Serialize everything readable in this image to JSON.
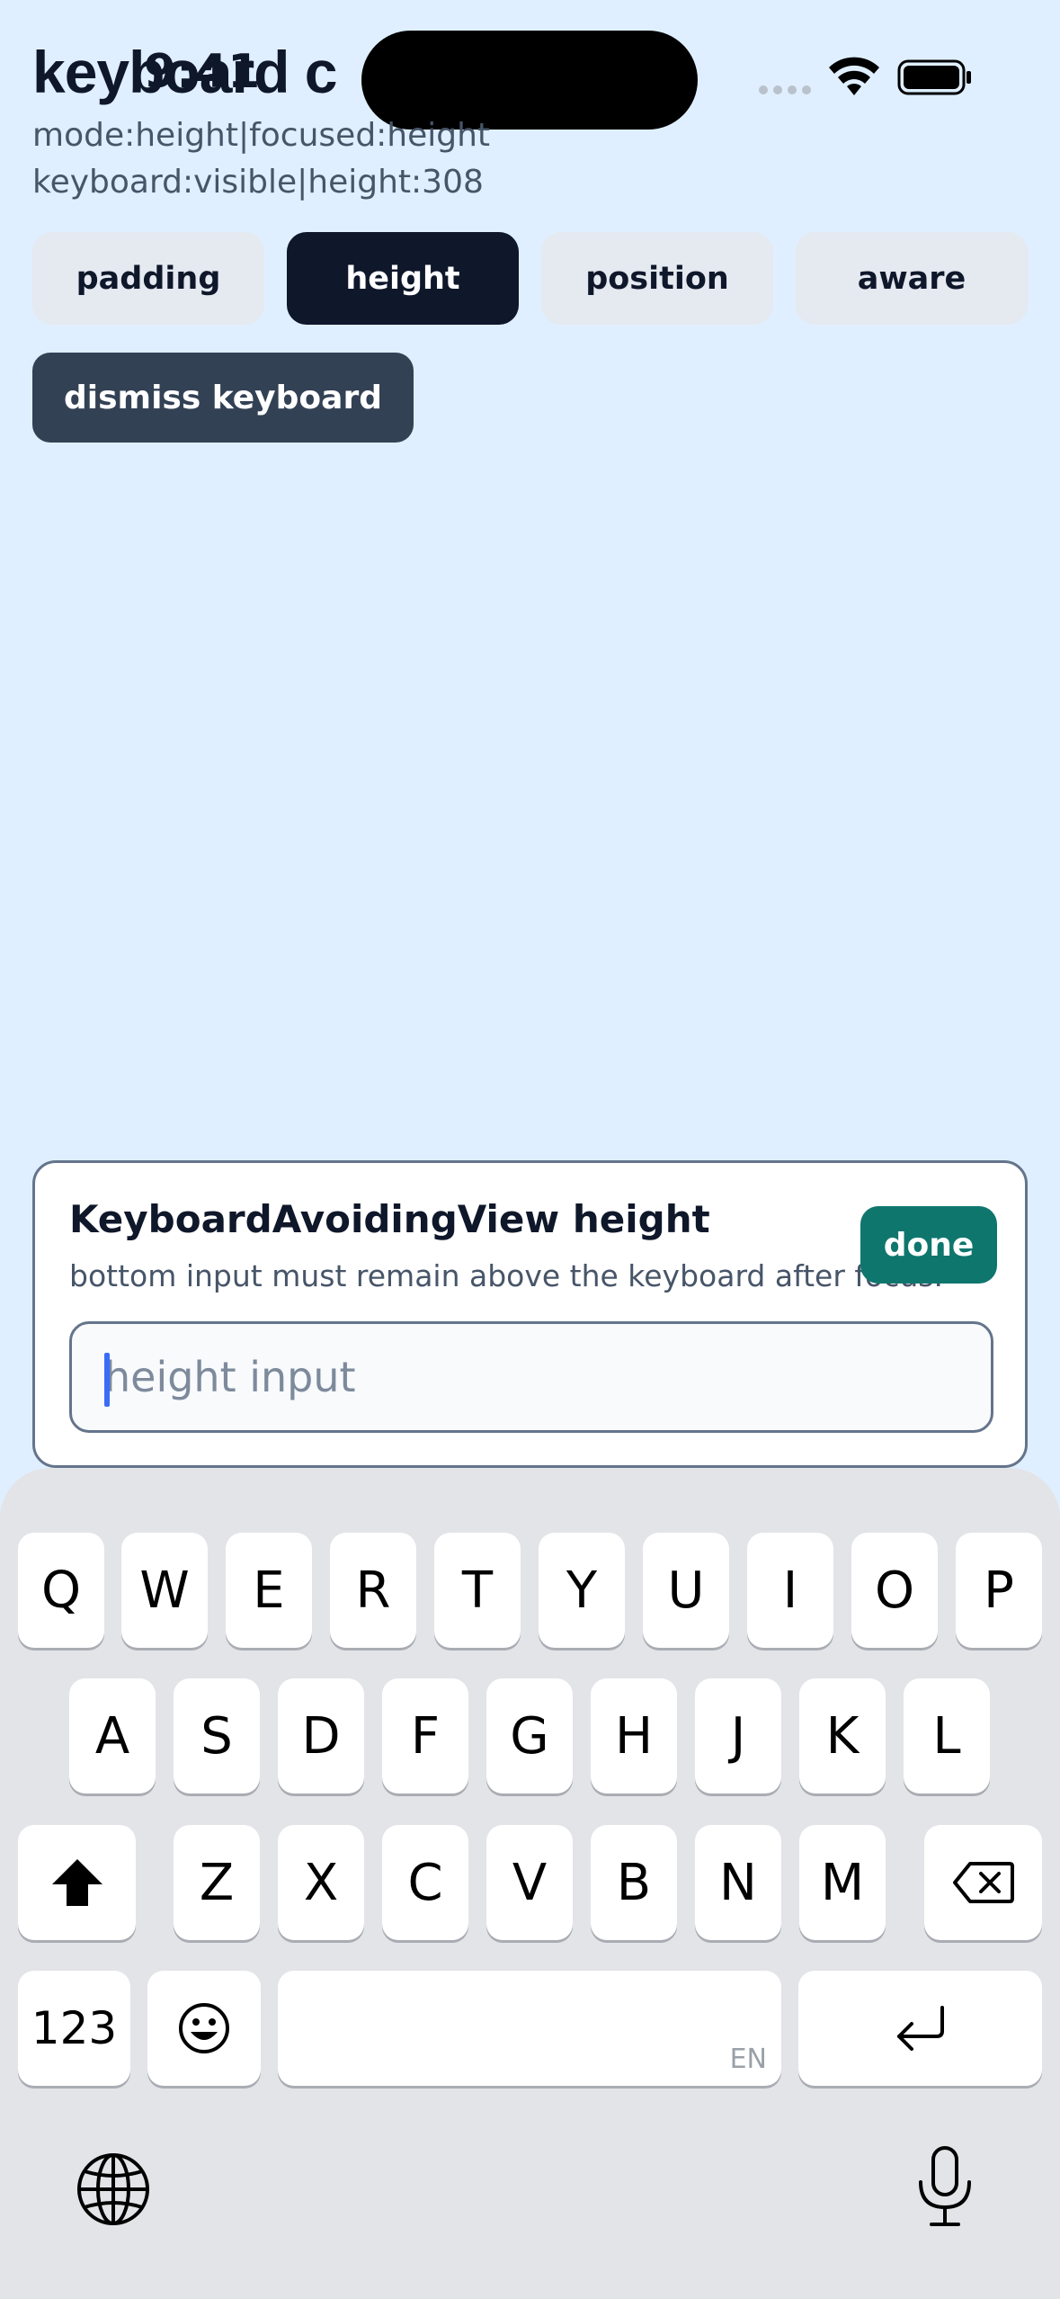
{
  "status_bar": {
    "time": "9:41"
  },
  "header": {
    "title": "keyboard c",
    "status_mode": "mode:height|focused:height",
    "status_keyboard": "keyboard:visible|height:308"
  },
  "modes": [
    {
      "label": "padding",
      "active": false
    },
    {
      "label": "height",
      "active": true
    },
    {
      "label": "position",
      "active": false
    },
    {
      "label": "aware",
      "active": false
    }
  ],
  "dismiss_label": "dismiss keyboard",
  "card": {
    "title": "KeyboardAvoidingView height",
    "subtitle": "bottom input must remain above the keyboard after focus.",
    "done_label": "done",
    "input_placeholder": "height input",
    "input_value": ""
  },
  "keyboard": {
    "row1": [
      "Q",
      "W",
      "E",
      "R",
      "T",
      "Y",
      "U",
      "I",
      "O",
      "P"
    ],
    "row2": [
      "A",
      "S",
      "D",
      "F",
      "G",
      "H",
      "J",
      "K",
      "L"
    ],
    "row3": [
      "Z",
      "X",
      "C",
      "V",
      "B",
      "N",
      "M"
    ],
    "numbers_label": "123",
    "language_label": "EN"
  }
}
